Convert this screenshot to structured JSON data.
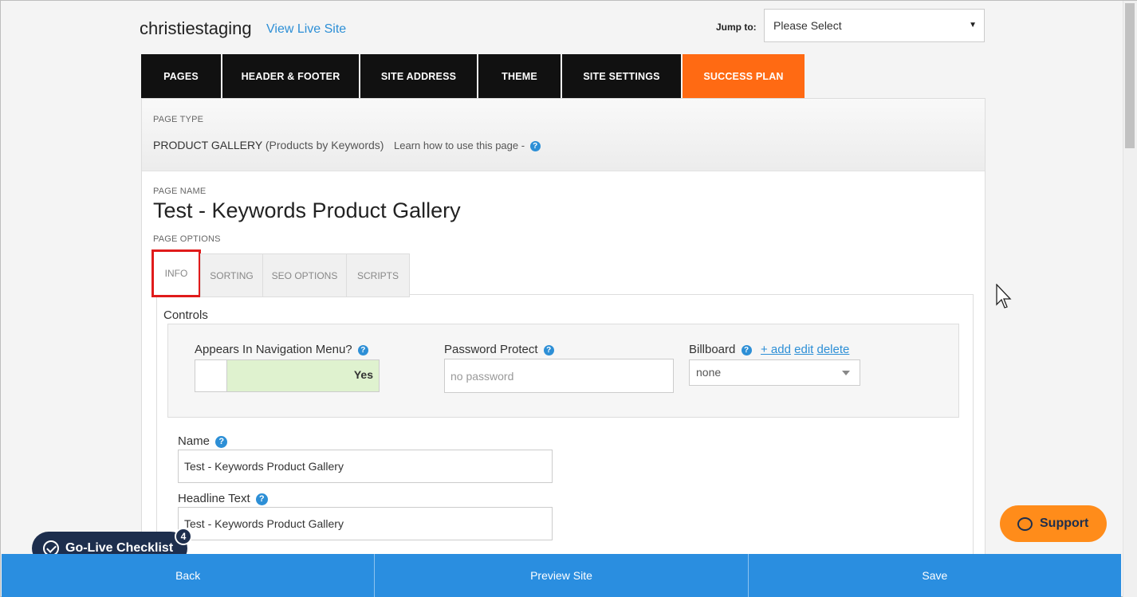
{
  "header": {
    "site_name": "christiestaging",
    "view_live_label": "View Live Site",
    "jump_label": "Jump to:",
    "jump_value": "Please Select"
  },
  "nav": {
    "tabs": [
      "PAGES",
      "HEADER & FOOTER",
      "SITE ADDRESS",
      "THEME",
      "SITE SETTINGS",
      "SUCCESS PLAN"
    ],
    "highlight_color": "#ff6a13"
  },
  "page": {
    "type_label": "PAGE TYPE",
    "type_value": "PRODUCT GALLERY",
    "type_sub": "(Products by Keywords)",
    "learn_text": "Learn how to use this page -",
    "name_label": "PAGE NAME",
    "name_value": "Test - Keywords Product Gallery",
    "options_label": "PAGE OPTIONS"
  },
  "subtabs": [
    "INFO",
    "SORTING",
    "SEO OPTIONS",
    "SCRIPTS"
  ],
  "controls": {
    "title": "Controls",
    "nav_menu_label": "Appears In Navigation Menu?",
    "nav_menu_value": "Yes",
    "password_label": "Password Protect",
    "password_placeholder": "no password",
    "billboard_label": "Billboard",
    "billboard_add": "+ add",
    "billboard_edit": "edit",
    "billboard_delete": "delete",
    "billboard_value": "none"
  },
  "fields": {
    "name_label": "Name",
    "name_value": "Test - Keywords Product Gallery",
    "headline_label": "Headline Text",
    "headline_value": "Test - Keywords Product Gallery"
  },
  "widgets": {
    "golive_label": "Go-Live Checklist",
    "golive_count": "4",
    "support_label": "Support",
    "help_glyph": "?"
  },
  "bottom": {
    "back": "Back",
    "preview": "Preview Site",
    "save": "Save"
  },
  "colors": {
    "accent_blue": "#2a8ee0",
    "success_orange": "#ff6a13",
    "support_orange": "#ff8c1a",
    "navy": "#1d2e4d"
  }
}
